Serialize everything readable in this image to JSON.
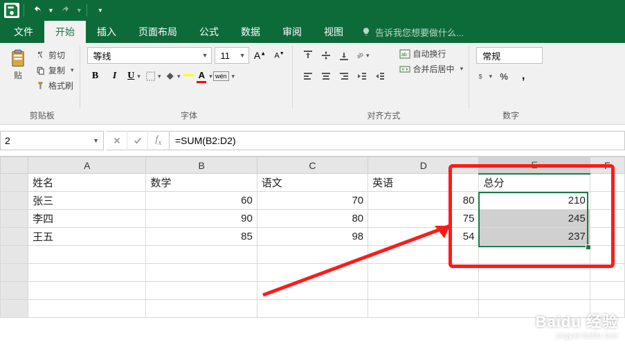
{
  "quickAccess": {
    "save": "save-icon",
    "undo": "undo-icon",
    "redo": "redo-icon"
  },
  "tabs": {
    "file": "文件",
    "home": "开始",
    "insert": "插入",
    "layout": "页面布局",
    "formulas": "公式",
    "data": "数据",
    "review": "审阅",
    "view": "视图",
    "tellMe": "告诉我您想要做什么..."
  },
  "ribbon": {
    "clipboard": {
      "paste": "贴",
      "cut": "剪切",
      "copy": "复制",
      "format": "格式刷",
      "label": "剪贴板"
    },
    "font": {
      "name": "等线",
      "size": "11",
      "bold": "B",
      "italic": "I",
      "underline": "U",
      "ruby": "wén",
      "label": "字体"
    },
    "align": {
      "wrap": "自动换行",
      "merge": "合并后居中",
      "label": "对齐方式"
    },
    "number": {
      "format": "常规",
      "percent": "%",
      "comma": ",",
      "label": "数字"
    }
  },
  "formulaBar": {
    "nameBox": "2",
    "formula": "=SUM(B2:D2)"
  },
  "columns": [
    "A",
    "B",
    "C",
    "D",
    "E",
    "F"
  ],
  "headers": {
    "name": "姓名",
    "math": "数学",
    "chinese": "语文",
    "english": "英语",
    "total": "总分"
  },
  "rows": [
    {
      "name": "张三",
      "math": "60",
      "chinese": "70",
      "english": "80",
      "total": "210"
    },
    {
      "name": "李四",
      "math": "90",
      "chinese": "80",
      "english": "75",
      "total": "245"
    },
    {
      "name": "王五",
      "math": "85",
      "chinese": "98",
      "english": "54",
      "total": "237"
    }
  ],
  "watermark": {
    "main": "Baidu 经验",
    "sub": "jingyan.baidu.com"
  },
  "chart_data": {
    "type": "table",
    "columns": [
      "姓名",
      "数学",
      "语文",
      "英语",
      "总分"
    ],
    "rows": [
      [
        "张三",
        60,
        70,
        80,
        210
      ],
      [
        "李四",
        90,
        80,
        75,
        245
      ],
      [
        "王五",
        85,
        98,
        54,
        237
      ]
    ],
    "formula_cell": "E2",
    "formula": "=SUM(B2:D2)"
  }
}
